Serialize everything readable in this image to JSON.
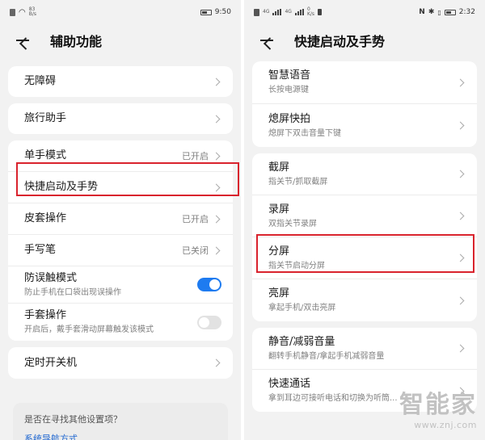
{
  "left": {
    "status": {
      "net_speed": "83",
      "net_unit": "B/s",
      "time": "9:50"
    },
    "title": "辅助功能",
    "groups": [
      [
        {
          "title": "无障碍"
        }
      ],
      [
        {
          "title": "旅行助手"
        }
      ],
      [
        {
          "title": "单手模式",
          "status": "已开启"
        },
        {
          "title": "快捷启动及手势"
        },
        {
          "title": "皮套操作",
          "status": "已开启"
        },
        {
          "title": "手写笔",
          "status": "已关闭"
        },
        {
          "title": "防误触模式",
          "sub": "防止手机在口袋出现误操作",
          "toggle": true
        },
        {
          "title": "手套操作",
          "sub": "开启后，戴手套滑动屏幕触发该模式",
          "toggle": false
        }
      ],
      [
        {
          "title": "定时开关机"
        }
      ]
    ],
    "suggest": {
      "question": "是否在寻找其他设置项？",
      "link": "系统导航方式"
    }
  },
  "right": {
    "status": {
      "net_speed": "0",
      "net_unit": "K/s",
      "time": "2:32",
      "sim1": "4G",
      "sim2": "4G"
    },
    "title": "快捷启动及手势",
    "groups": [
      [
        {
          "title": "智慧语音",
          "sub": "长按电源键"
        },
        {
          "title": "熄屏快拍",
          "sub": "熄屏下双击音量下键"
        }
      ],
      [
        {
          "title": "截屏",
          "sub": "指关节/抓取截屏"
        },
        {
          "title": "录屏",
          "sub": "双指关节录屏"
        },
        {
          "title": "分屏",
          "sub": "指关节启动分屏"
        },
        {
          "title": "亮屏",
          "sub": "拿起手机/双击亮屏"
        }
      ],
      [
        {
          "title": "静音/减弱音量",
          "sub": "翻转手机静音/拿起手机减弱音量"
        },
        {
          "title": "快速通话",
          "sub": "拿到耳边可接听电话和切换为听筒..."
        }
      ]
    ]
  },
  "watermark": {
    "brand": "智能家",
    "url": "www.znj.com"
  },
  "colors": {
    "highlight": "#d9232d",
    "toggle_on": "#1e7bf0",
    "link": "#1e66d0"
  }
}
